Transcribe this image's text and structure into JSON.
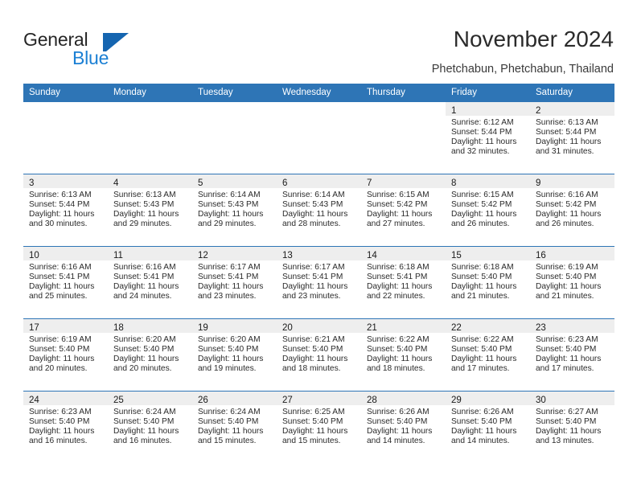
{
  "brand": {
    "name_part1": "General",
    "name_part2": "Blue",
    "logo_icon": "triangle-logo-icon",
    "accent_color": "#1565b0",
    "blue_text_color": "#1a7fd4"
  },
  "header": {
    "title": "November 2024",
    "subtitle": "Phetchabun, Phetchabun, Thailand"
  },
  "calendar": {
    "header_bg": "#2e75b6",
    "daynum_band_bg": "#eeeeee",
    "weekday_headers": [
      "Sunday",
      "Monday",
      "Tuesday",
      "Wednesday",
      "Thursday",
      "Friday",
      "Saturday"
    ],
    "weeks": [
      [
        {
          "day": "",
          "sunrise": "",
          "sunset": "",
          "daylight_line1": "",
          "daylight_line2": ""
        },
        {
          "day": "",
          "sunrise": "",
          "sunset": "",
          "daylight_line1": "",
          "daylight_line2": ""
        },
        {
          "day": "",
          "sunrise": "",
          "sunset": "",
          "daylight_line1": "",
          "daylight_line2": ""
        },
        {
          "day": "",
          "sunrise": "",
          "sunset": "",
          "daylight_line1": "",
          "daylight_line2": ""
        },
        {
          "day": "",
          "sunrise": "",
          "sunset": "",
          "daylight_line1": "",
          "daylight_line2": ""
        },
        {
          "day": "1",
          "sunrise": "Sunrise: 6:12 AM",
          "sunset": "Sunset: 5:44 PM",
          "daylight_line1": "Daylight: 11 hours",
          "daylight_line2": "and 32 minutes."
        },
        {
          "day": "2",
          "sunrise": "Sunrise: 6:13 AM",
          "sunset": "Sunset: 5:44 PM",
          "daylight_line1": "Daylight: 11 hours",
          "daylight_line2": "and 31 minutes."
        }
      ],
      [
        {
          "day": "3",
          "sunrise": "Sunrise: 6:13 AM",
          "sunset": "Sunset: 5:44 PM",
          "daylight_line1": "Daylight: 11 hours",
          "daylight_line2": "and 30 minutes."
        },
        {
          "day": "4",
          "sunrise": "Sunrise: 6:13 AM",
          "sunset": "Sunset: 5:43 PM",
          "daylight_line1": "Daylight: 11 hours",
          "daylight_line2": "and 29 minutes."
        },
        {
          "day": "5",
          "sunrise": "Sunrise: 6:14 AM",
          "sunset": "Sunset: 5:43 PM",
          "daylight_line1": "Daylight: 11 hours",
          "daylight_line2": "and 29 minutes."
        },
        {
          "day": "6",
          "sunrise": "Sunrise: 6:14 AM",
          "sunset": "Sunset: 5:43 PM",
          "daylight_line1": "Daylight: 11 hours",
          "daylight_line2": "and 28 minutes."
        },
        {
          "day": "7",
          "sunrise": "Sunrise: 6:15 AM",
          "sunset": "Sunset: 5:42 PM",
          "daylight_line1": "Daylight: 11 hours",
          "daylight_line2": "and 27 minutes."
        },
        {
          "day": "8",
          "sunrise": "Sunrise: 6:15 AM",
          "sunset": "Sunset: 5:42 PM",
          "daylight_line1": "Daylight: 11 hours",
          "daylight_line2": "and 26 minutes."
        },
        {
          "day": "9",
          "sunrise": "Sunrise: 6:16 AM",
          "sunset": "Sunset: 5:42 PM",
          "daylight_line1": "Daylight: 11 hours",
          "daylight_line2": "and 26 minutes."
        }
      ],
      [
        {
          "day": "10",
          "sunrise": "Sunrise: 6:16 AM",
          "sunset": "Sunset: 5:41 PM",
          "daylight_line1": "Daylight: 11 hours",
          "daylight_line2": "and 25 minutes."
        },
        {
          "day": "11",
          "sunrise": "Sunrise: 6:16 AM",
          "sunset": "Sunset: 5:41 PM",
          "daylight_line1": "Daylight: 11 hours",
          "daylight_line2": "and 24 minutes."
        },
        {
          "day": "12",
          "sunrise": "Sunrise: 6:17 AM",
          "sunset": "Sunset: 5:41 PM",
          "daylight_line1": "Daylight: 11 hours",
          "daylight_line2": "and 23 minutes."
        },
        {
          "day": "13",
          "sunrise": "Sunrise: 6:17 AM",
          "sunset": "Sunset: 5:41 PM",
          "daylight_line1": "Daylight: 11 hours",
          "daylight_line2": "and 23 minutes."
        },
        {
          "day": "14",
          "sunrise": "Sunrise: 6:18 AM",
          "sunset": "Sunset: 5:41 PM",
          "daylight_line1": "Daylight: 11 hours",
          "daylight_line2": "and 22 minutes."
        },
        {
          "day": "15",
          "sunrise": "Sunrise: 6:18 AM",
          "sunset": "Sunset: 5:40 PM",
          "daylight_line1": "Daylight: 11 hours",
          "daylight_line2": "and 21 minutes."
        },
        {
          "day": "16",
          "sunrise": "Sunrise: 6:19 AM",
          "sunset": "Sunset: 5:40 PM",
          "daylight_line1": "Daylight: 11 hours",
          "daylight_line2": "and 21 minutes."
        }
      ],
      [
        {
          "day": "17",
          "sunrise": "Sunrise: 6:19 AM",
          "sunset": "Sunset: 5:40 PM",
          "daylight_line1": "Daylight: 11 hours",
          "daylight_line2": "and 20 minutes."
        },
        {
          "day": "18",
          "sunrise": "Sunrise: 6:20 AM",
          "sunset": "Sunset: 5:40 PM",
          "daylight_line1": "Daylight: 11 hours",
          "daylight_line2": "and 20 minutes."
        },
        {
          "day": "19",
          "sunrise": "Sunrise: 6:20 AM",
          "sunset": "Sunset: 5:40 PM",
          "daylight_line1": "Daylight: 11 hours",
          "daylight_line2": "and 19 minutes."
        },
        {
          "day": "20",
          "sunrise": "Sunrise: 6:21 AM",
          "sunset": "Sunset: 5:40 PM",
          "daylight_line1": "Daylight: 11 hours",
          "daylight_line2": "and 18 minutes."
        },
        {
          "day": "21",
          "sunrise": "Sunrise: 6:22 AM",
          "sunset": "Sunset: 5:40 PM",
          "daylight_line1": "Daylight: 11 hours",
          "daylight_line2": "and 18 minutes."
        },
        {
          "day": "22",
          "sunrise": "Sunrise: 6:22 AM",
          "sunset": "Sunset: 5:40 PM",
          "daylight_line1": "Daylight: 11 hours",
          "daylight_line2": "and 17 minutes."
        },
        {
          "day": "23",
          "sunrise": "Sunrise: 6:23 AM",
          "sunset": "Sunset: 5:40 PM",
          "daylight_line1": "Daylight: 11 hours",
          "daylight_line2": "and 17 minutes."
        }
      ],
      [
        {
          "day": "24",
          "sunrise": "Sunrise: 6:23 AM",
          "sunset": "Sunset: 5:40 PM",
          "daylight_line1": "Daylight: 11 hours",
          "daylight_line2": "and 16 minutes."
        },
        {
          "day": "25",
          "sunrise": "Sunrise: 6:24 AM",
          "sunset": "Sunset: 5:40 PM",
          "daylight_line1": "Daylight: 11 hours",
          "daylight_line2": "and 16 minutes."
        },
        {
          "day": "26",
          "sunrise": "Sunrise: 6:24 AM",
          "sunset": "Sunset: 5:40 PM",
          "daylight_line1": "Daylight: 11 hours",
          "daylight_line2": "and 15 minutes."
        },
        {
          "day": "27",
          "sunrise": "Sunrise: 6:25 AM",
          "sunset": "Sunset: 5:40 PM",
          "daylight_line1": "Daylight: 11 hours",
          "daylight_line2": "and 15 minutes."
        },
        {
          "day": "28",
          "sunrise": "Sunrise: 6:26 AM",
          "sunset": "Sunset: 5:40 PM",
          "daylight_line1": "Daylight: 11 hours",
          "daylight_line2": "and 14 minutes."
        },
        {
          "day": "29",
          "sunrise": "Sunrise: 6:26 AM",
          "sunset": "Sunset: 5:40 PM",
          "daylight_line1": "Daylight: 11 hours",
          "daylight_line2": "and 14 minutes."
        },
        {
          "day": "30",
          "sunrise": "Sunrise: 6:27 AM",
          "sunset": "Sunset: 5:40 PM",
          "daylight_line1": "Daylight: 11 hours",
          "daylight_line2": "and 13 minutes."
        }
      ]
    ]
  }
}
